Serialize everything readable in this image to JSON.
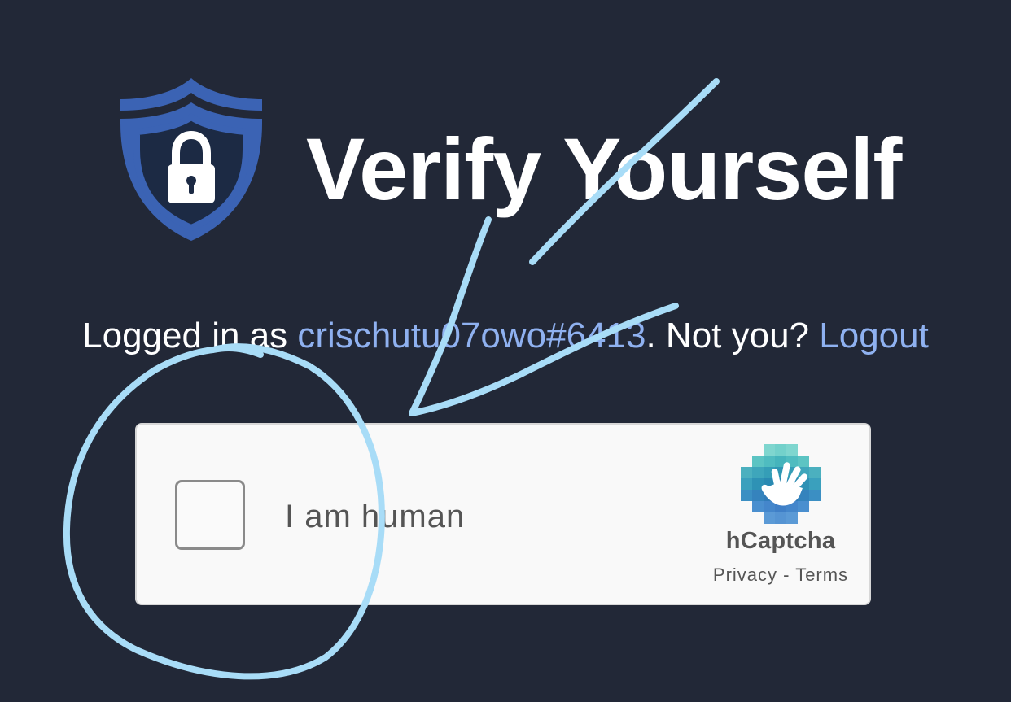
{
  "header": {
    "title": "Verify Yourself"
  },
  "login": {
    "prefix": "Logged in as ",
    "username": "crischutu07owo#6413",
    "middle": ". Not you? ",
    "logout": "Logout"
  },
  "captcha": {
    "label": "I am human",
    "brand": "hCaptcha",
    "privacy": "Privacy",
    "separator": " - ",
    "terms": "Terms",
    "checked": false
  },
  "colors": {
    "background": "#222837",
    "link": "#8fb1f0",
    "shield": "#3b63b4",
    "annotation": "#a8dcf7"
  }
}
